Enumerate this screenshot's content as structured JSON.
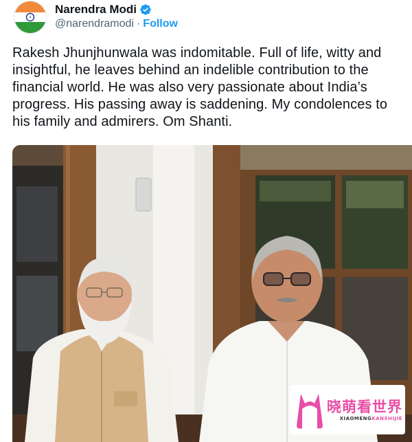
{
  "author": {
    "display_name": "Narendra Modi",
    "handle": "@narendramodi",
    "separator": "·",
    "follow_label": "Follow",
    "verified": true,
    "avatar_icon": "india-flag-icon"
  },
  "tweet": {
    "text": "Rakesh Jhunjhunwala was indomitable. Full of life, witty and insightful, he leaves behind an indelible contribution to the financial world. He was also very passionate about India’s progress. His passing away is saddening. My condolences to his family and admirers. Om Shanti."
  },
  "watermark": {
    "title": "晓萌看世界",
    "subtitle_part1": "XIAOMENG",
    "subtitle_part2": "KANSHIJIE"
  },
  "colors": {
    "link": "#1d9bf0",
    "verified": "#1d9bf0",
    "text_primary": "#0f1419",
    "text_secondary": "#536471",
    "watermark_pink": "#e84ea6"
  }
}
